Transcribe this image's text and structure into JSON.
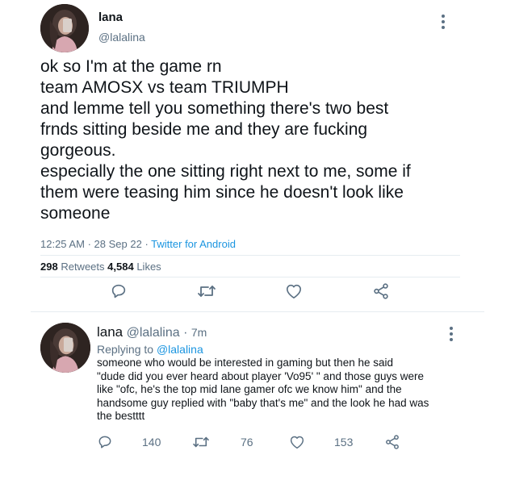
{
  "main_tweet": {
    "display_name": "lana",
    "handle": "@lalalina",
    "lines": [
      "ok so I'm at the game rn",
      "team AMOSX vs team TRIUMPH",
      "and lemme tell you something there's two best",
      "frnds sitting beside me and they are fucking",
      "gorgeous.",
      "especially the one sitting right next to me, some if",
      "them were teasing him since he doesn't look like",
      "someone"
    ],
    "time": "12:25 AM",
    "date": "28 Sep 22",
    "source": "Twitter for Android",
    "sep": "·",
    "retweets_count": "298",
    "retweets_label": "Retweets",
    "likes_count": "4,584",
    "likes_label": "Likes"
  },
  "reply_tweet": {
    "display_name": "lana",
    "handle": "@lalalina",
    "sep": "·",
    "age": "7m",
    "replying_label": "Replying to",
    "replying_handle": "@lalalina",
    "lines": [
      "someone who would be interested in gaming but then he said",
      "\"dude did you ever heard about player 'Vo95' \" and those guys were",
      "like \"ofc, he's the top mid lane gamer ofc we know him\" and the",
      "handsome guy replied with \"baby that's me\" and the look he had was",
      "the bestttt"
    ],
    "reply_count": "140",
    "retweet_count": "76",
    "like_count": "153"
  },
  "colors": {
    "text": "#0f1419",
    "muted": "#5b7083",
    "link": "#1b95e0",
    "divider": "#e6ecf0"
  },
  "icons": [
    "more-icon",
    "reply-icon",
    "retweet-icon",
    "like-icon",
    "share-icon"
  ]
}
